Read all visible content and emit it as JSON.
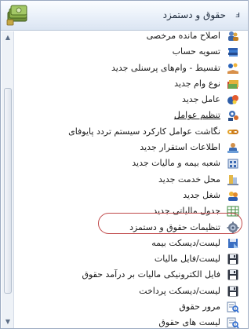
{
  "header": {
    "title": "حقوق و دستمزد",
    "pin_glyph": "ⅎ"
  },
  "scrollbar": {
    "up_glyph": "▲",
    "down_glyph": "▼"
  },
  "menu": {
    "items": [
      {
        "label": "اصلاح مانده مرخصی",
        "icon": "users-edit-icon"
      },
      {
        "label": "تسویه حساب",
        "icon": "book-stack-icon"
      },
      {
        "label": "تقسیط - وام‌های پرسنلی جدید",
        "icon": "hand-coins-icon"
      },
      {
        "label": "نوع وام جدید",
        "icon": "folders-icon"
      },
      {
        "label": "عامل جدید",
        "icon": "factor-icon"
      },
      {
        "label": "تنظیم عوامل",
        "icon": "settings-users-icon"
      },
      {
        "label": "نگاشت عوامل کارکرد سیستم تردد پایوفای",
        "icon": "link-icon"
      },
      {
        "label": "اطلاعات استقرار جدید",
        "icon": "user-info-icon"
      },
      {
        "label": "شعبه بیمه و مالیات جدید",
        "icon": "branch-icon"
      },
      {
        "label": "محل خدمت جدید",
        "icon": "building-icon"
      },
      {
        "label": "شغل جدید",
        "icon": "job-icon"
      },
      {
        "label": "جدول مالیاتی جدید",
        "icon": "grid-table-icon"
      },
      {
        "label": "تنظیمات حقوق و دستمزد",
        "icon": "gear-icon"
      },
      {
        "label": "لیست/دیسکت بیمه",
        "icon": "diskette-insurance-icon"
      },
      {
        "label": "لیست/فایل مالیات",
        "icon": "floppy-disk-icon"
      },
      {
        "label": "فایل الکترونیکی مالیات بر درآمد حقوق",
        "icon": "floppy-disk-icon"
      },
      {
        "label": "لیست/دیسکت پرداخت",
        "icon": "floppy-disk-icon"
      },
      {
        "label": "مرور حقوق",
        "icon": "magnifier-report-icon"
      },
      {
        "label": "لیست های حقوق",
        "icon": "magnifier-report-icon"
      }
    ]
  },
  "colors": {
    "highlight_ring": "#c0494a",
    "header_gradient_top": "#fbfdff",
    "header_gradient_bottom": "#dbe5f2"
  }
}
